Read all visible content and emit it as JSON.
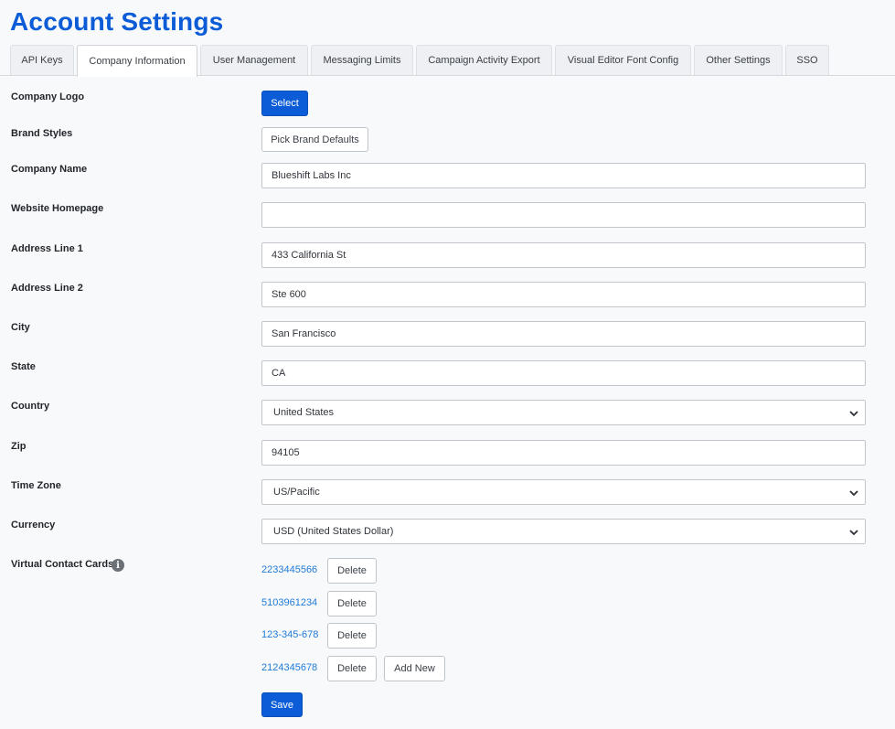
{
  "page": {
    "title": "Account Settings"
  },
  "tabs": [
    {
      "label": "API Keys",
      "active": false
    },
    {
      "label": "Company Information",
      "active": true
    },
    {
      "label": "User Management",
      "active": false
    },
    {
      "label": "Messaging Limits",
      "active": false
    },
    {
      "label": "Campaign Activity Export",
      "active": false
    },
    {
      "label": "Visual Editor Font Config",
      "active": false
    },
    {
      "label": "Other Settings",
      "active": false
    },
    {
      "label": "SSO",
      "active": false
    }
  ],
  "form": {
    "company_logo": {
      "label": "Company Logo",
      "button": "Select"
    },
    "brand_styles": {
      "label": "Brand Styles",
      "button": "Pick Brand Defaults"
    },
    "company_name": {
      "label": "Company Name",
      "value": "Blueshift Labs Inc"
    },
    "website_homepage": {
      "label": "Website Homepage",
      "value": ""
    },
    "address_line_1": {
      "label": "Address Line 1",
      "value": "433 California St"
    },
    "address_line_2": {
      "label": "Address Line 2",
      "value": "Ste 600"
    },
    "city": {
      "label": "City",
      "value": "San Francisco"
    },
    "state": {
      "label": "State",
      "value": "CA"
    },
    "country": {
      "label": "Country",
      "value": "United States"
    },
    "zip": {
      "label": "Zip",
      "value": "94105"
    },
    "time_zone": {
      "label": "Time Zone",
      "value": "US/Pacific"
    },
    "currency": {
      "label": "Currency",
      "value": "USD (United States Dollar)"
    },
    "virtual_contact_cards": {
      "label": "Virtual Contact Cards",
      "info_icon": "info-icon",
      "cards": [
        {
          "number": "2233445566",
          "delete_label": "Delete"
        },
        {
          "number": "5103961234",
          "delete_label": "Delete"
        },
        {
          "number": "123-345-678",
          "delete_label": "Delete"
        },
        {
          "number": "2124345678",
          "delete_label": "Delete"
        }
      ],
      "add_new_label": "Add New"
    },
    "save_label": "Save"
  },
  "colors": {
    "accent": "#0b5cd6",
    "link": "#1f7ad6",
    "background": "#f8f9fb"
  }
}
